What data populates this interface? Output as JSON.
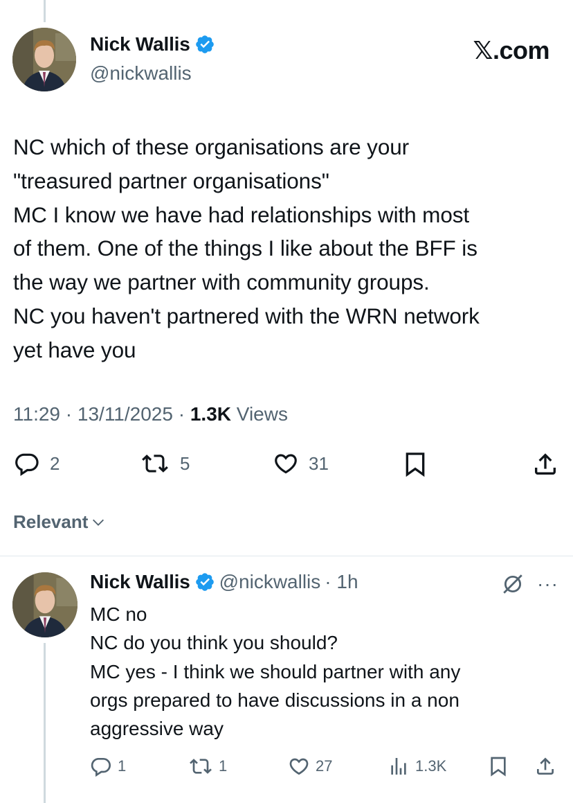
{
  "brand": {
    "watermark": "𝕏.com"
  },
  "colors": {
    "verified": "#1d9bf0",
    "muted": "#536471",
    "text": "#0f1419",
    "thread_line": "#cfd9de"
  },
  "main_tweet": {
    "author_name": "Nick Wallis",
    "handle": "@nickwallis",
    "body_lines": [
      "NC which of these organisations are your",
      "\"treasured partner organisations\"",
      "MC I know we have had relationships with most",
      "of them. One of the things I like about the BFF is",
      "the way we partner with community groups.",
      "NC you haven't partnered with the WRN network",
      "yet have you"
    ],
    "time": "11:29",
    "date": "13/11/2025",
    "views_count": "1.3K",
    "views_label": "Views",
    "separator": "·",
    "replies": "2",
    "reposts": "5",
    "likes": "31"
  },
  "sort": {
    "label": "Relevant"
  },
  "reply": {
    "author_name": "Nick Wallis",
    "handle": "@nickwallis",
    "age": "· 1h",
    "body_lines": [
      "MC no",
      "NC do you think you should?",
      "MC yes - I think we should partner with any",
      "orgs prepared to have discussions in a non",
      "aggressive way"
    ],
    "replies": "1",
    "reposts": "1",
    "likes": "27",
    "views": "1.3K",
    "more": "···"
  },
  "icons": [
    "verified-badge-icon",
    "reply-icon",
    "repost-icon",
    "like-icon",
    "bookmark-icon",
    "share-icon",
    "views-icon",
    "no-grok-icon",
    "chevron-down-icon",
    "more-icon"
  ]
}
